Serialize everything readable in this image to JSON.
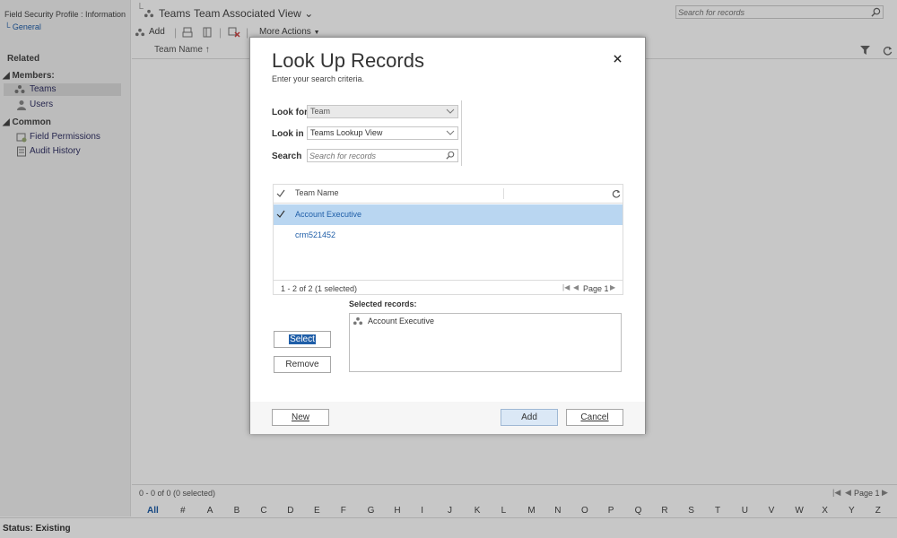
{
  "left_nav": {
    "title": "Field Security Profile : Information",
    "general_link": "General",
    "related_heading": "Related",
    "members_heading": "Members:",
    "teams": "Teams",
    "users": "Users",
    "common_heading": "Common",
    "field_permissions": "Field Permissions",
    "audit_history": "Audit History"
  },
  "header": {
    "entity": "Teams",
    "view_name": "Team Associated View",
    "search_placeholder": "Search for records",
    "add_label": "Add",
    "more_actions": "More Actions"
  },
  "grid": {
    "column": "Team Name",
    "footer_count": "0 - 0 of 0 (0 selected)",
    "page_label": "Page 1",
    "alphabet": [
      "All",
      "#",
      "A",
      "B",
      "C",
      "D",
      "E",
      "F",
      "G",
      "H",
      "I",
      "J",
      "K",
      "L",
      "M",
      "N",
      "O",
      "P",
      "Q",
      "R",
      "S",
      "T",
      "U",
      "V",
      "W",
      "X",
      "Y",
      "Z"
    ]
  },
  "status": {
    "text": "Status: Existing"
  },
  "dialog": {
    "title": "Look Up Records",
    "subtitle": "Enter your search criteria.",
    "look_for_label": "Look for",
    "look_for_value": "Team",
    "look_in_label": "Look in",
    "look_in_value": "Teams Lookup View",
    "search_label": "Search",
    "search_placeholder": "Search for records",
    "results_column": "Team Name",
    "results": [
      {
        "name": "Account Executive",
        "selected": true
      },
      {
        "name": "crm521452",
        "selected": false
      }
    ],
    "results_count": "1 - 2 of 2 (1 selected)",
    "page_label": "Page 1",
    "selected_records_label": "Selected records:",
    "selected_records": [
      "Account Executive"
    ],
    "select_button": "Select",
    "remove_button": "Remove",
    "new_button": "New",
    "add_button": "Add",
    "cancel_button": "Cancel",
    "accent_color": "#1f5ea8",
    "selection_color": "#b9d6f1"
  }
}
